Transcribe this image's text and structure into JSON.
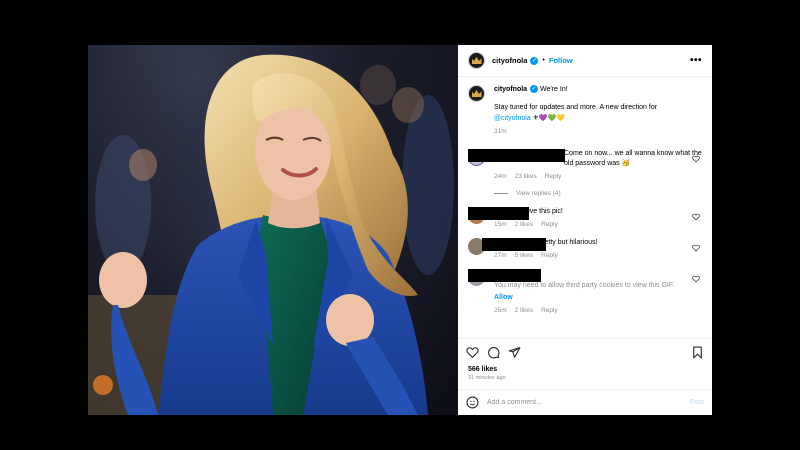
{
  "header": {
    "username": "cityofnola",
    "separator": "•",
    "follow_label": "Follow",
    "more_icon": "more-horizontal-icon"
  },
  "caption": {
    "username": "cityofnola",
    "title": "We're In!",
    "text": "Stay tuned for updates and more. A new direction for",
    "mention": "@cityofnola",
    "emojis": "⚜💜💚💛",
    "time": "31m"
  },
  "comments": [
    {
      "text": "Come on now... we all wanna know what the old password was 🥳",
      "time": "24m",
      "likes": "23 likes",
      "reply": "Reply"
    },
    {
      "text": "Love this pic!",
      "time": "15m",
      "likes": "2 likes",
      "reply": "Reply"
    },
    {
      "text": "o Petty but hilarious!",
      "time": "27m",
      "likes": "5 likes",
      "reply": "Reply"
    },
    {
      "text": "You may need to allow third party cookies to view this GIF.",
      "allow": "Allow",
      "time": "25m",
      "likes": "2 likes",
      "reply": "Reply"
    }
  ],
  "view_replies": "View replies (4)",
  "likes": "566 likes",
  "posted": "31 minutes ago",
  "add_comment": {
    "placeholder": "Add a comment...",
    "post_label": "Post"
  },
  "colors": {
    "accent": "#0095f6",
    "muted": "#8e8e8e",
    "verified": "#0095f6"
  }
}
